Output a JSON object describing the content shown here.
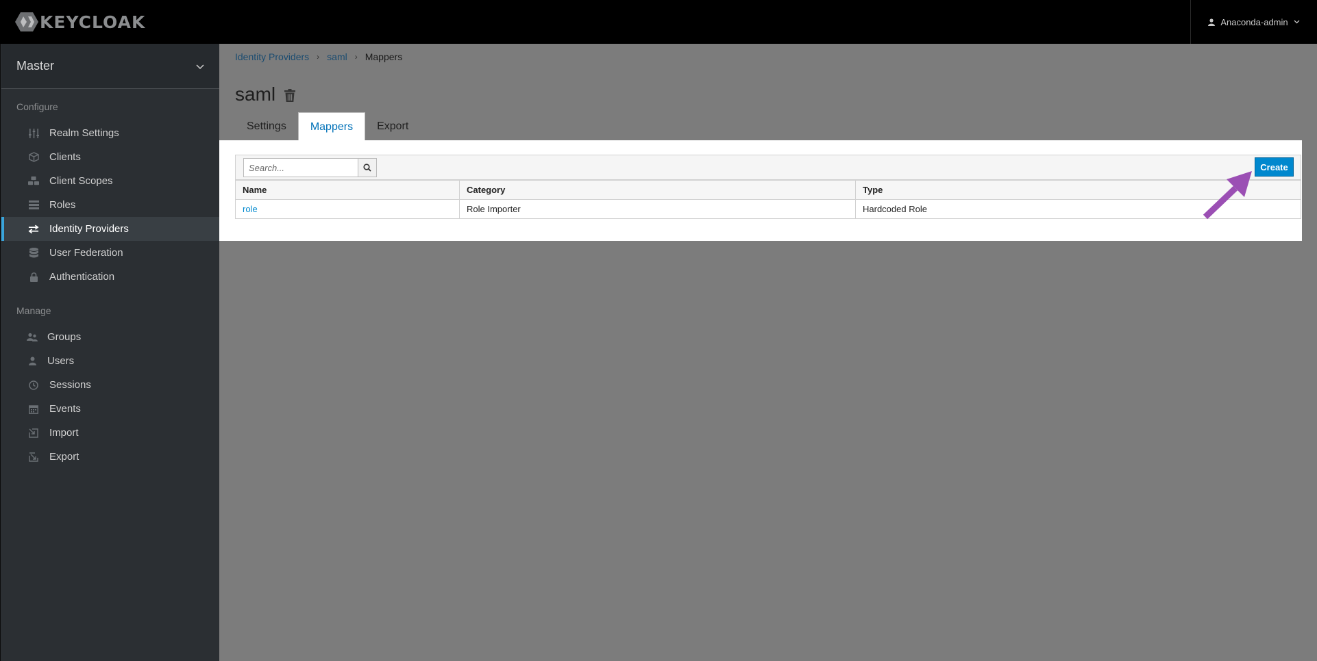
{
  "header": {
    "logo_text": "KEYCLOAK",
    "user_name": "Anaconda-admin"
  },
  "sidebar": {
    "realm": "Master",
    "configure_label": "Configure",
    "manage_label": "Manage",
    "configure_items": [
      {
        "label": "Realm Settings",
        "icon": "sliders-icon"
      },
      {
        "label": "Clients",
        "icon": "cube-icon"
      },
      {
        "label": "Client Scopes",
        "icon": "cubes-icon"
      },
      {
        "label": "Roles",
        "icon": "list-icon"
      },
      {
        "label": "Identity Providers",
        "icon": "exchange-icon",
        "active": true
      },
      {
        "label": "User Federation",
        "icon": "database-icon"
      },
      {
        "label": "Authentication",
        "icon": "lock-icon"
      }
    ],
    "manage_items": [
      {
        "label": "Groups",
        "icon": "users-icon"
      },
      {
        "label": "Users",
        "icon": "user-icon"
      },
      {
        "label": "Sessions",
        "icon": "clock-icon"
      },
      {
        "label": "Events",
        "icon": "calendar-icon"
      },
      {
        "label": "Import",
        "icon": "import-icon"
      },
      {
        "label": "Export",
        "icon": "export-icon"
      }
    ]
  },
  "breadcrumb": [
    "Identity Providers",
    "saml",
    "Mappers"
  ],
  "page": {
    "title": "saml",
    "tabs": [
      "Settings",
      "Mappers",
      "Export"
    ],
    "active_tab": "Mappers"
  },
  "toolbar": {
    "search_placeholder": "Search...",
    "create_label": "Create"
  },
  "table": {
    "columns": [
      "Name",
      "Category",
      "Type"
    ],
    "rows": [
      {
        "name": "role",
        "category": "Role Importer",
        "type": "Hardcoded Role"
      }
    ]
  },
  "colors": {
    "accent": "#0088ce",
    "annotation_arrow": "#9b4fb4",
    "sidebar_active": "#39a5dc"
  }
}
